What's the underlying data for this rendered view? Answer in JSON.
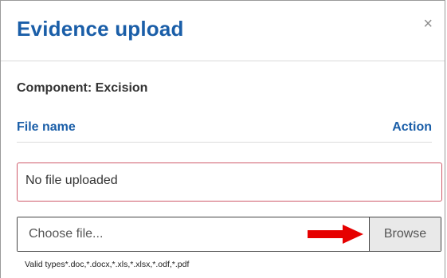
{
  "dialog": {
    "title": "Evidence upload",
    "close_label": "×",
    "component": "Component: Excision"
  },
  "table": {
    "columns": [
      "File name",
      "Action"
    ],
    "empty_message": "No file uploaded"
  },
  "upload": {
    "placeholder": "Choose file...",
    "browse_label": "Browse",
    "valid_types": "Valid types*.doc,*.docx,*.xls,*.xlsx,*.odf,*.pdf"
  },
  "colors": {
    "title": "#1a5ea8",
    "empty_border": "#cf5a6a",
    "arrow": "#e60000"
  },
  "icons": {
    "close": "close-icon",
    "annotation": "red-arrow-icon"
  }
}
